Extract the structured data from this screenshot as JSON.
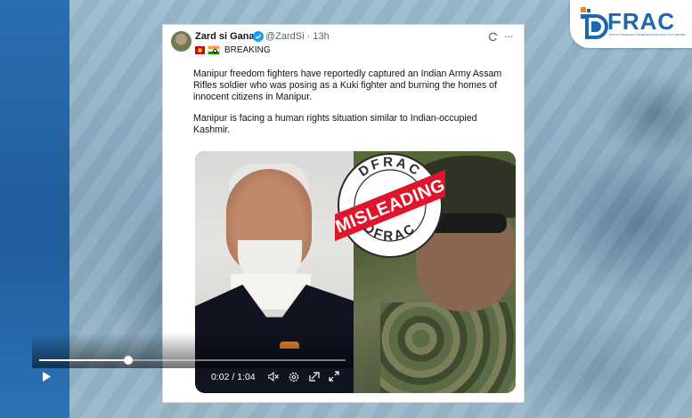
{
  "brand": {
    "name": "FRAC",
    "tagline": "DIGITAL FORENSICS, RESEARCH AND ANALYTICS CENTRE",
    "color": "#1f66b0"
  },
  "tweet": {
    "display_name": "Zard si Gana",
    "handle": "@ZardSi",
    "time_ago": "· 13h",
    "flags": [
      "manipur-flag",
      "india-flag"
    ],
    "label": "BREAKING",
    "paragraphs": [
      "Manipur freedom fighters have reportedly captured an Indian Army Assam Rifles soldier who was posing as a Kuki fighter and burning the homes of innocent citizens in Manipur.",
      "Manipur is facing a human rights situation similar to Indian-occupied Kashmir."
    ]
  },
  "stamp": {
    "top": "DFRAC",
    "bottom": "DFRAC",
    "verdict": "MISLEADING",
    "color": "#e0152b"
  },
  "video": {
    "time": "0:02 / 1:04",
    "progress": 0.29
  }
}
